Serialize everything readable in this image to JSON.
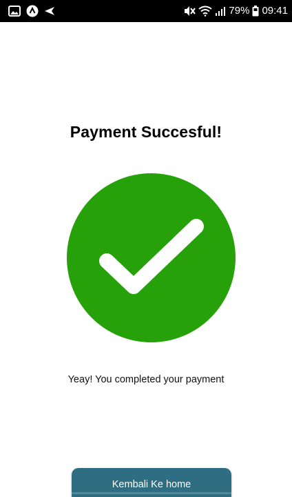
{
  "status_bar": {
    "battery_percent": "79%",
    "time": "09:41",
    "icons_left": [
      "image-icon",
      "app-a-icon",
      "send-icon"
    ],
    "icons_right": [
      "mute-icon",
      "wifi-icon",
      "signal-icon",
      "battery-icon"
    ]
  },
  "main": {
    "title": "Payment Succesful!",
    "message": "Yeay! You completed your payment",
    "success_color": "#27a10a",
    "button_label": "Kembali Ke home",
    "button_color": "#2f6d82"
  }
}
